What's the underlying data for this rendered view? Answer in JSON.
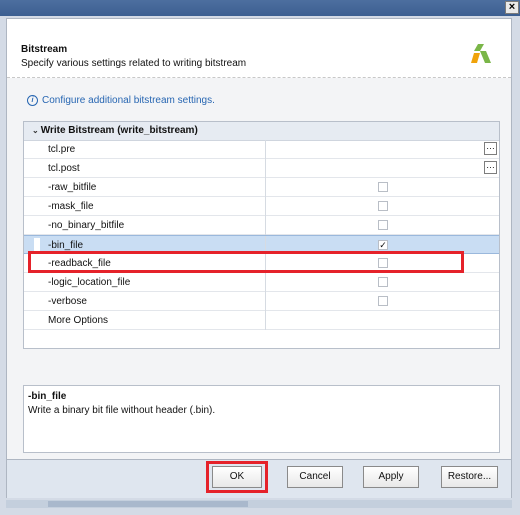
{
  "titlebar": {
    "close_glyph": "×"
  },
  "header": {
    "title": "Bitstream",
    "subtitle": "Specify various settings related to writing bitstream",
    "logo_icon": "xilinx-logo-icon"
  },
  "info_link": "Configure additional bitstream settings.",
  "group": {
    "label": "Write Bitstream (write_bitstream)"
  },
  "rows": [
    {
      "name": "tcl.pre",
      "type": "file"
    },
    {
      "name": "tcl.post",
      "type": "file"
    },
    {
      "name": "-raw_bitfile",
      "type": "checkbox",
      "checked": false
    },
    {
      "name": "-mask_file",
      "type": "checkbox",
      "checked": false
    },
    {
      "name": "-no_binary_bitfile",
      "type": "checkbox",
      "checked": false
    },
    {
      "name": "-bin_file",
      "type": "checkbox",
      "checked": true,
      "mark": "✓"
    },
    {
      "name": "-readback_file",
      "type": "checkbox",
      "checked": false
    },
    {
      "name": "-logic_location_file",
      "type": "checkbox",
      "checked": false
    },
    {
      "name": "-verbose",
      "type": "checkbox",
      "checked": false
    },
    {
      "name": "More Options",
      "type": "text"
    }
  ],
  "description": {
    "title": "-bin_file",
    "text": "Write a binary bit file without header (.bin)."
  },
  "buttons": {
    "ok": "OK",
    "cancel": "Cancel",
    "apply": "Apply",
    "restore": "Restore..."
  },
  "colors": {
    "highlight": "#e5222a",
    "selection": "#c9ddf3",
    "link": "#2766b2"
  }
}
